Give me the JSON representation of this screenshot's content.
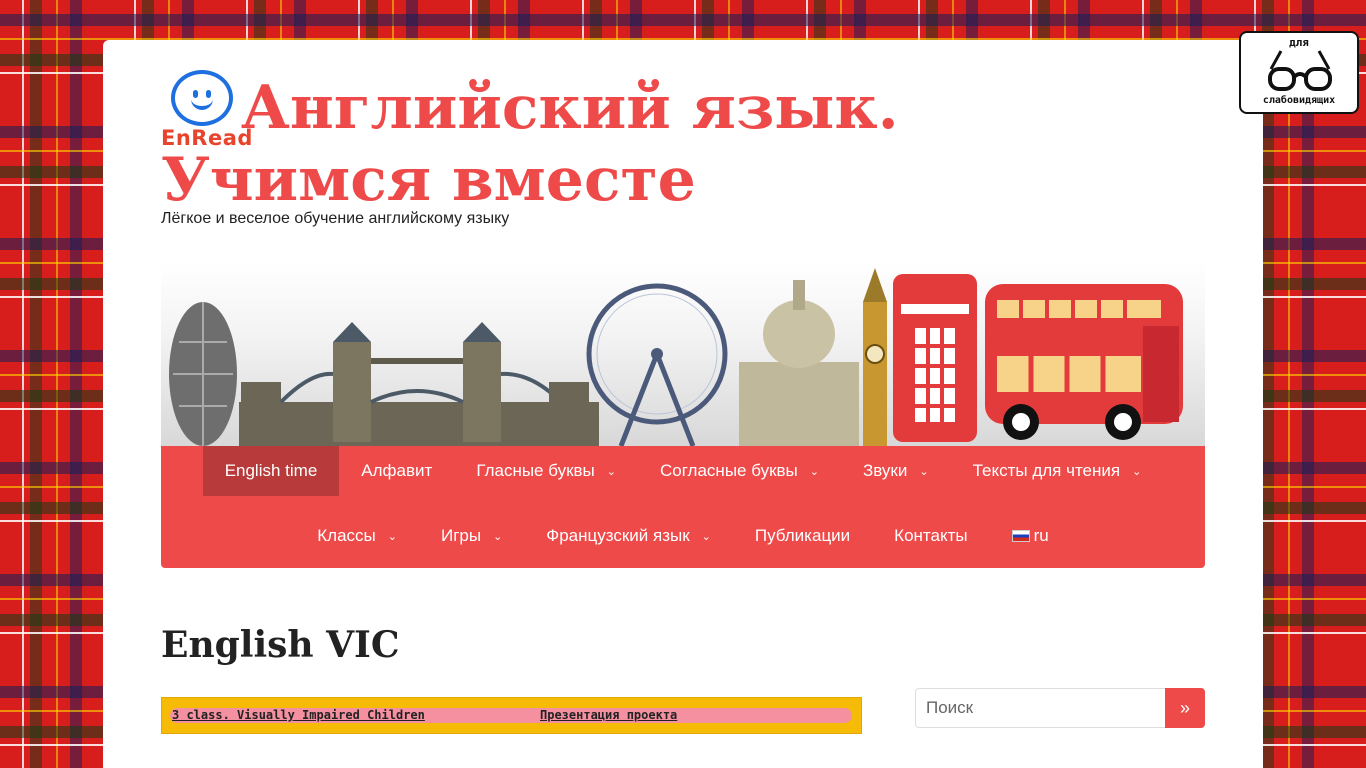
{
  "site": {
    "logo_text": "EnRead",
    "title": "Английский язык. Учимся вместе",
    "tagline": "Лёгкое и веселое обучение английскому языку"
  },
  "nav": {
    "row1": [
      {
        "label": "English time",
        "active": true,
        "dropdown": false
      },
      {
        "label": "Алфавит",
        "dropdown": false
      },
      {
        "label": "Гласные буквы",
        "dropdown": true
      },
      {
        "label": "Согласные буквы",
        "dropdown": true
      },
      {
        "label": "Звуки",
        "dropdown": true
      },
      {
        "label": "Тексты для чтения",
        "dropdown": true
      }
    ],
    "row2": [
      {
        "label": "Классы",
        "dropdown": true
      },
      {
        "label": "Игры",
        "dropdown": true
      },
      {
        "label": "Французский язык",
        "dropdown": true
      },
      {
        "label": "Публикации",
        "dropdown": false
      },
      {
        "label": "Контакты",
        "dropdown": false
      },
      {
        "label": "ru",
        "flag": "ru-flag-icon",
        "dropdown": false
      }
    ],
    "chevron": "⌄"
  },
  "main": {
    "title": "English VIC",
    "promo_link1": "3 class. Visually Impaired Children",
    "promo_link2": "Презентация проекта"
  },
  "search": {
    "placeholder": "Поиск",
    "button_label": "»"
  },
  "accessibility": {
    "top_label": "для",
    "bottom_label": "слабовидящих",
    "icon": "glasses-icon"
  },
  "colors": {
    "accent": "#ee4a4a",
    "active_nav": "#b83a3a",
    "promo_bg": "#f6bb06",
    "promo_inner": "#f590a0"
  }
}
